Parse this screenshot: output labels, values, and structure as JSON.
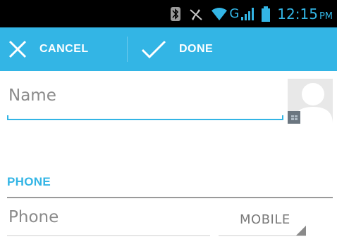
{
  "status_bar": {
    "time": "12:15",
    "ampm": "PM",
    "network": "G",
    "icons": [
      "bluetooth-icon",
      "muted-icon",
      "wifi-icon",
      "signal-icon",
      "battery-icon"
    ],
    "accent": "#33b5e5"
  },
  "action_bar": {
    "cancel_label": "CANCEL",
    "done_label": "DONE",
    "background": "#33b5e5"
  },
  "form": {
    "name_placeholder": "Name",
    "phone_section_label": "PHONE",
    "phone_placeholder": "Phone",
    "phone_type": "MOBILE"
  }
}
